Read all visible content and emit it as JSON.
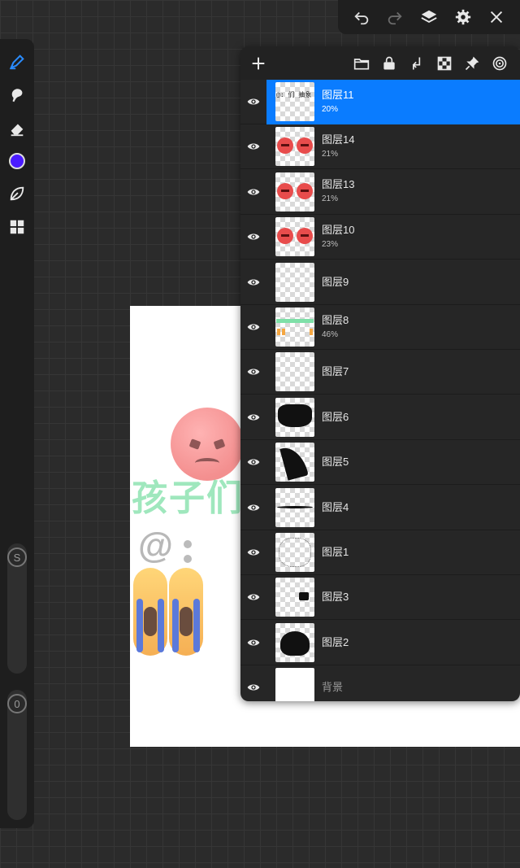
{
  "toolbar": {
    "undo_icon": "undo-icon",
    "redo_icon": "redo-icon",
    "layers_icon": "layers-icon",
    "settings_icon": "gear-icon",
    "close_icon": "close-icon"
  },
  "left_tools": {
    "brush_icon": "brush-icon",
    "smudge_icon": "smudge-icon",
    "eraser_icon": "eraser-icon",
    "color": "#4a1bff",
    "leaf_icon": "leaf-icon",
    "grid_icon": "grid-icon",
    "size_slider_label": "S",
    "opacity_slider_label": "0"
  },
  "layers_panel": {
    "header_icons": [
      "add-icon",
      "folder-icon",
      "lock-icon",
      "merge-down-icon",
      "checker-icon",
      "pin-icon",
      "reference-icon"
    ],
    "layers": [
      {
        "name": "图层11",
        "opacity": "20%",
        "selected": true,
        "thumb": "text"
      },
      {
        "name": "图层14",
        "opacity": "21%",
        "selected": false,
        "thumb": "angry"
      },
      {
        "name": "图层13",
        "opacity": "21%",
        "selected": false,
        "thumb": "angry"
      },
      {
        "name": "图层10",
        "opacity": "23%",
        "selected": false,
        "thumb": "angry"
      },
      {
        "name": "图层9",
        "opacity": "",
        "selected": false,
        "thumb": "empty"
      },
      {
        "name": "图层8",
        "opacity": "46%",
        "selected": false,
        "thumb": "green"
      },
      {
        "name": "图层7",
        "opacity": "",
        "selected": false,
        "thumb": "empty"
      },
      {
        "name": "图层6",
        "opacity": "",
        "selected": false,
        "thumb": "hair-top"
      },
      {
        "name": "图层5",
        "opacity": "",
        "selected": false,
        "thumb": "hair-side"
      },
      {
        "name": "图层4",
        "opacity": "",
        "selected": false,
        "thumb": "line"
      },
      {
        "name": "图层1",
        "opacity": "",
        "selected": false,
        "thumb": "sketch"
      },
      {
        "name": "图层3",
        "opacity": "",
        "selected": false,
        "thumb": "dot"
      },
      {
        "name": "图层2",
        "opacity": "",
        "selected": false,
        "thumb": "hair"
      },
      {
        "name": "背景",
        "opacity": "",
        "selected": false,
        "thumb": "white"
      }
    ],
    "thumb_text": "@: 们 抽象 ?"
  },
  "canvas": {
    "green_text": "孩子们不",
    "at_text": "@"
  }
}
